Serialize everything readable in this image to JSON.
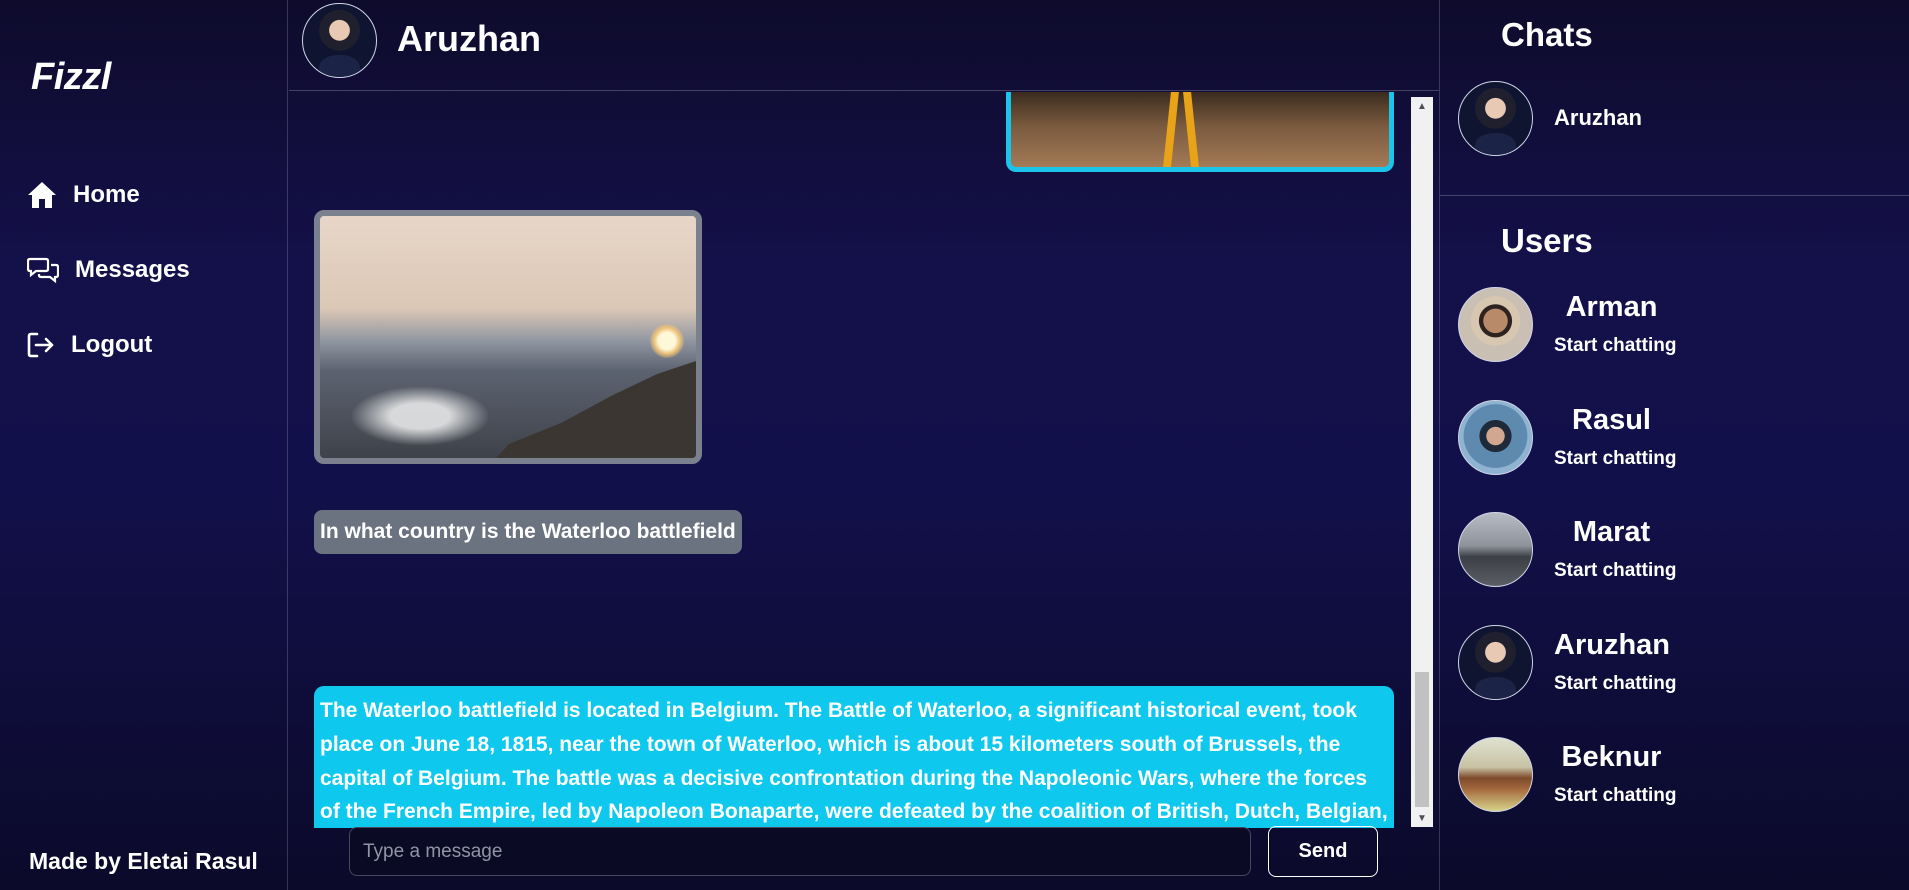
{
  "app": {
    "logo": "Fizzl",
    "credit": "Made by Eletai Rasul"
  },
  "nav": {
    "home": "Home",
    "messages": "Messages",
    "logout": "Logout"
  },
  "chat": {
    "contact_name": "Aruzhan",
    "question": "In what country is the Waterloo battlefield",
    "answer": "The Waterloo battlefield is located in Belgium. The Battle of Waterloo, a significant historical event, took place on June 18, 1815, near the town of Waterloo, which is about 15 kilometers south of Brussels, the capital of Belgium. The battle was a decisive confrontation during the Napoleonic Wars, where the forces of the French Empire, led by Napoleon Bonaparte, were defeated by the coalition of British, Dutch, Belgian, and German forces under the command of the Duke of Wellington and the Prussian Army led by Gebhard Leberecht von Blücher.",
    "input_placeholder": "Type a message",
    "input_value": "",
    "send_label": "Send"
  },
  "panel": {
    "chats_title": "Chats",
    "chats": [
      {
        "name": "Aruzhan"
      }
    ],
    "users_title": "Users",
    "users": [
      {
        "name": "Arman",
        "status": "Start chatting"
      },
      {
        "name": "Rasul",
        "status": "Start chatting"
      },
      {
        "name": "Marat",
        "status": "Start chatting"
      },
      {
        "name": "Aruzhan",
        "status": "Start chatting"
      },
      {
        "name": "Beknur",
        "status": "Start chatting"
      }
    ]
  },
  "colors": {
    "accent_cyan": "#0fc8ee",
    "bubble_grey": "#6c7380",
    "background": "#12104a"
  },
  "icons": [
    "home-icon",
    "messages-icon",
    "logout-icon"
  ]
}
